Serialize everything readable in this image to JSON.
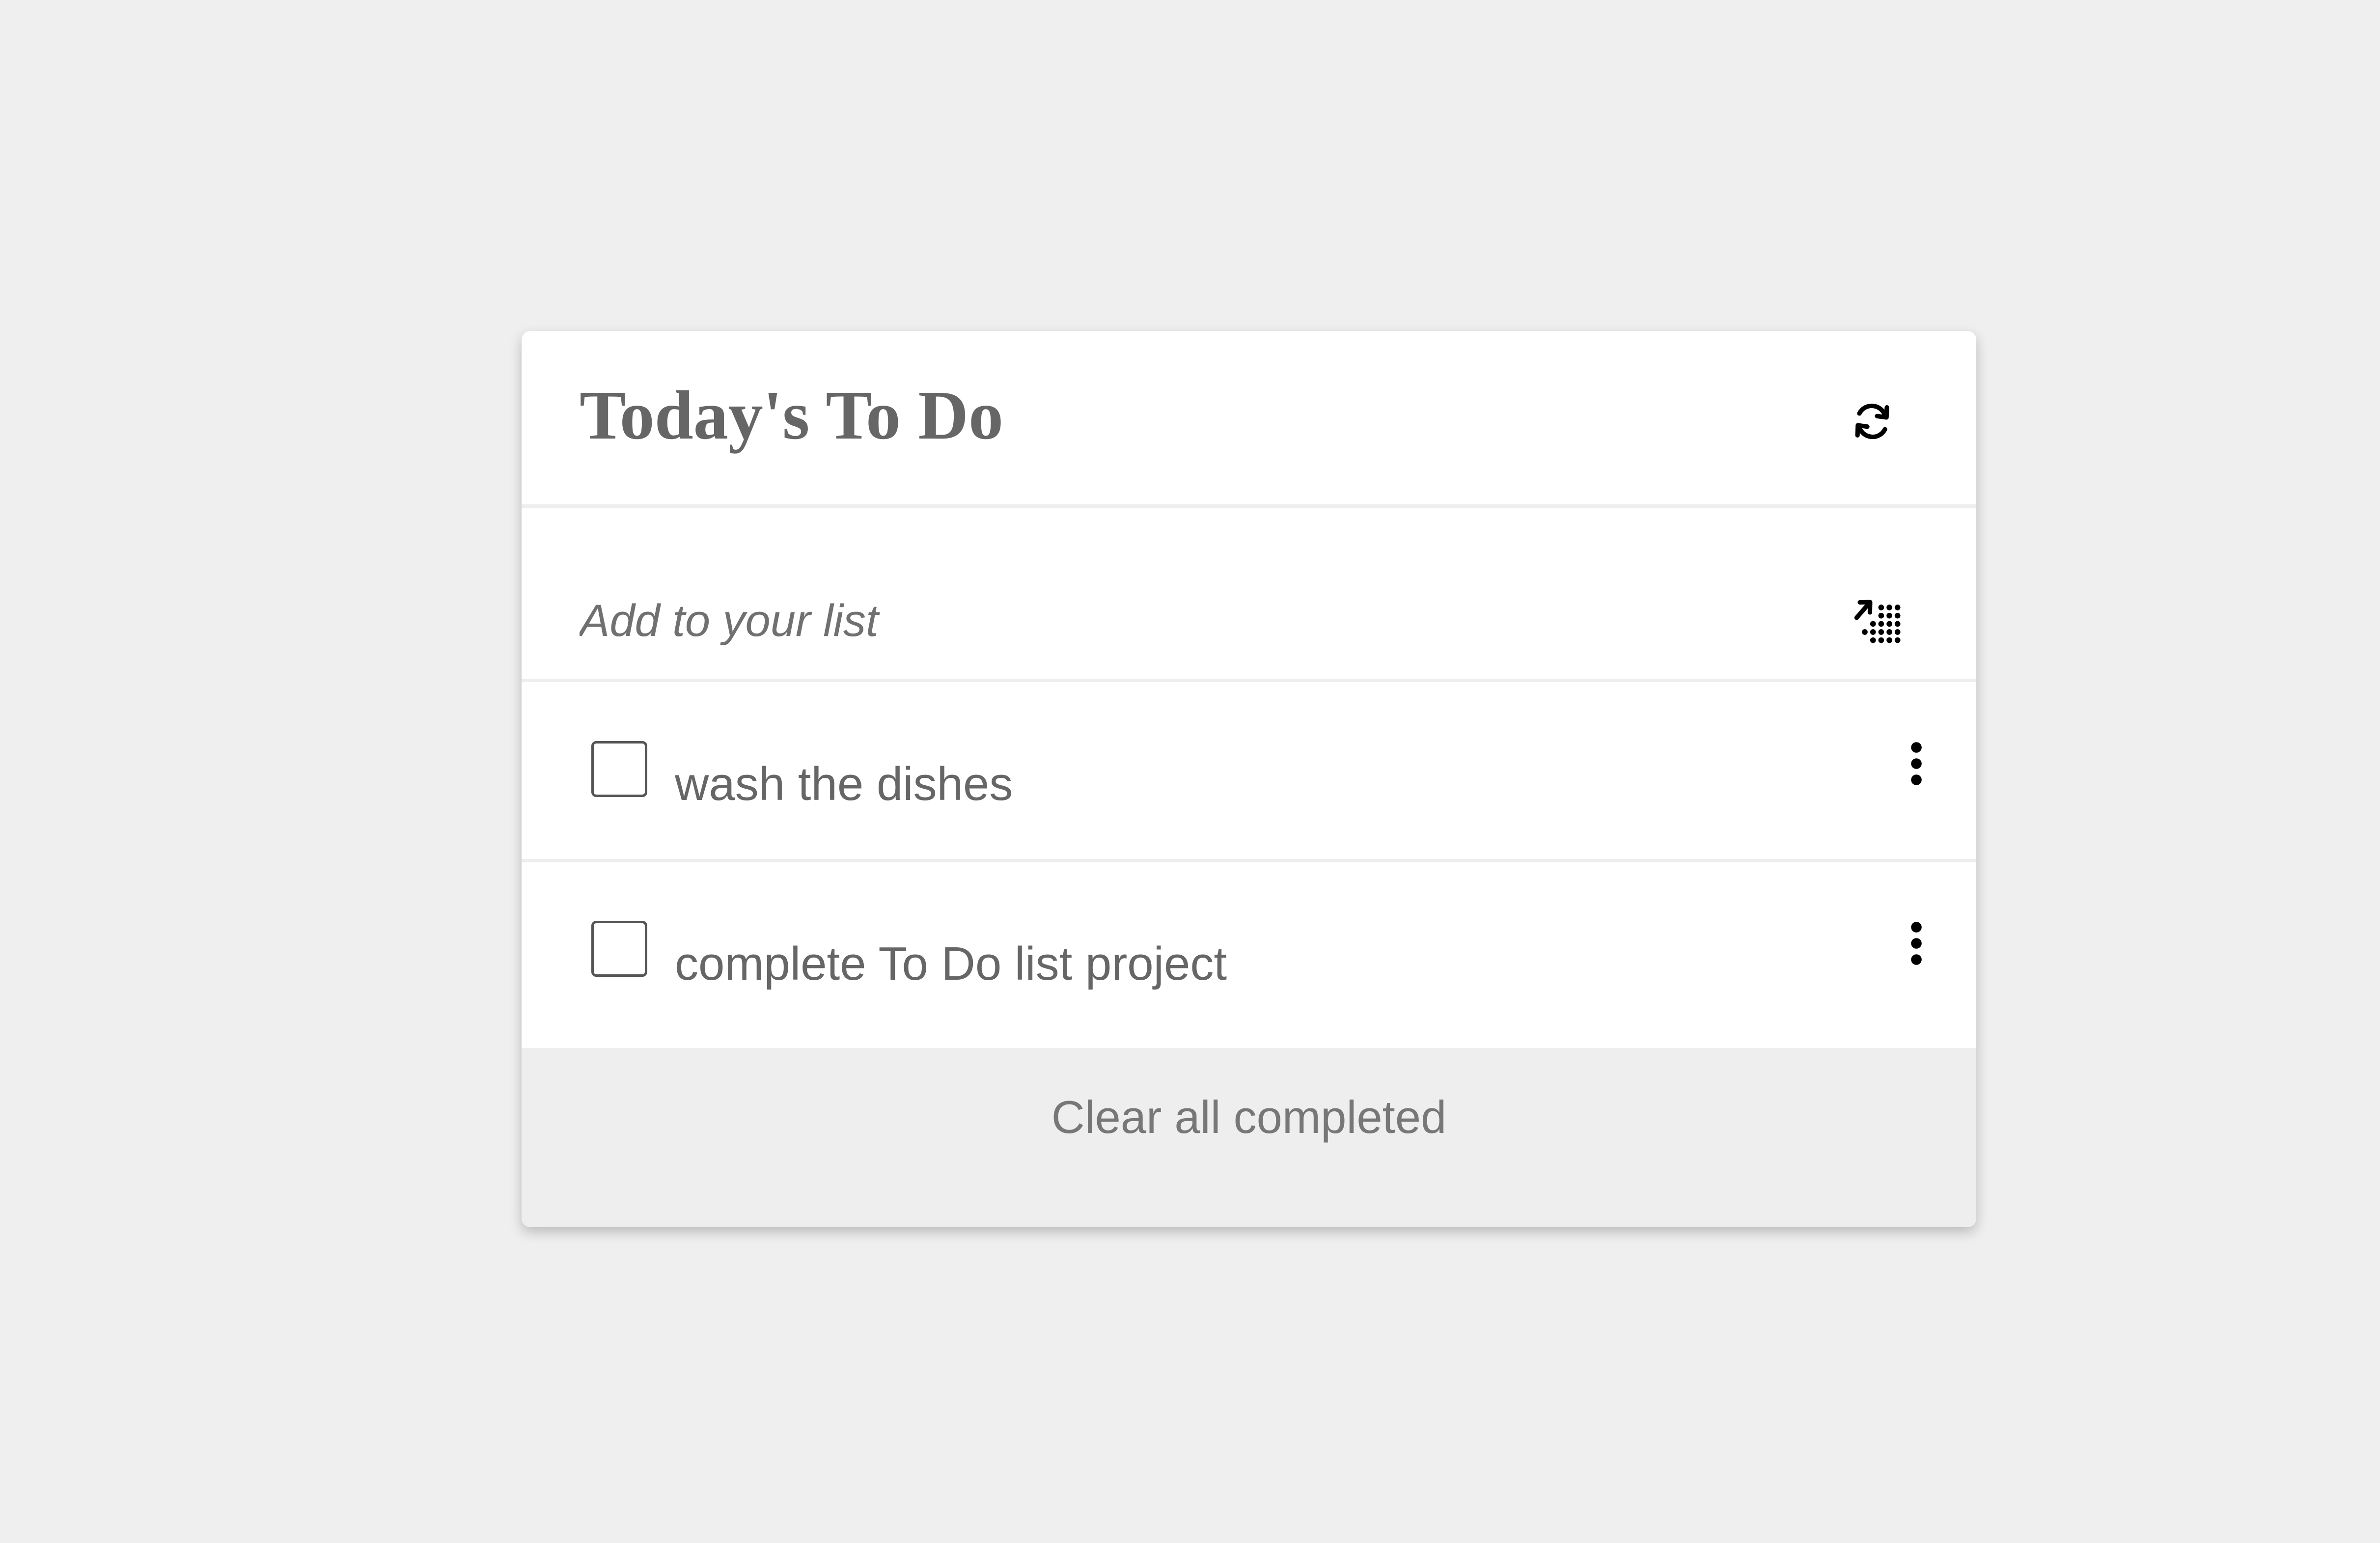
{
  "card": {
    "title": "Today's To Do",
    "refresh_icon": "refresh-icon"
  },
  "add": {
    "placeholder": "Add to your list",
    "add_icon": "add-to-list-icon"
  },
  "items": [
    {
      "text": "wash the dishes",
      "checked": false,
      "menu_icon": "more-vertical-icon"
    },
    {
      "text": "complete To Do list project",
      "checked": false,
      "menu_icon": "more-vertical-icon"
    }
  ],
  "footer": {
    "clear_label": "Clear all completed"
  },
  "colors": {
    "background": "#efefef",
    "card": "#ffffff",
    "text": "#666666",
    "footer": "#eeeeee"
  }
}
